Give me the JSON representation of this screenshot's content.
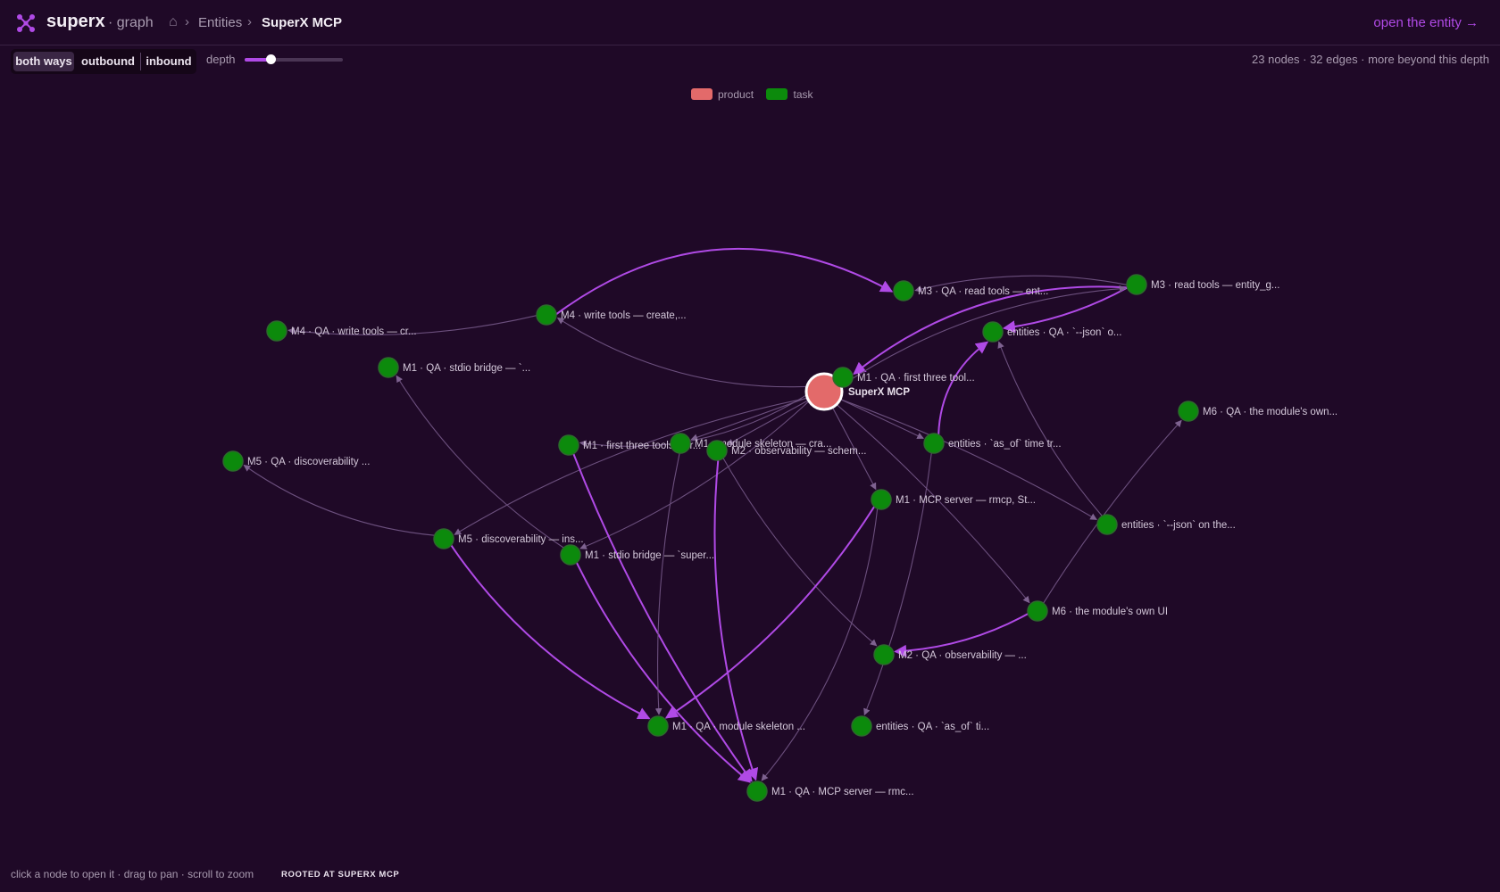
{
  "header": {
    "brand": "superx",
    "brand_suffix": "· graph",
    "home_icon": "⌂",
    "breadcrumb_sep": "›",
    "breadcrumb_parent": "Entities",
    "breadcrumb_current": "SuperX MCP",
    "open_link": "open the entity →"
  },
  "controls": {
    "directions": [
      "both ways",
      "outbound",
      "inbound"
    ],
    "active_direction": "both ways",
    "depth_label": "depth",
    "depth_fraction": 0.26,
    "stats": "23 nodes · 32 edges · more beyond this depth"
  },
  "legend": [
    {
      "label": "product",
      "color": "#e36a6a"
    },
    {
      "label": "task",
      "color": "#0c8a0c"
    }
  ],
  "colors": {
    "background": "#1f0927",
    "accent": "#b04ae6",
    "edge_muted": "#6b4f7d",
    "node_task": "#0c8a0c",
    "node_product": "#e36a6a"
  },
  "graph": {
    "nodes": [
      {
        "id": "root",
        "label": "SuperX MCP",
        "type": "product"
      },
      {
        "id": "m3qa",
        "label": "M3 · QA · read tools — ent...",
        "type": "task"
      },
      {
        "id": "m3",
        "label": "M3 · read tools — entity_g...",
        "type": "task"
      },
      {
        "id": "m4",
        "label": "M4 · write tools — create,...",
        "type": "task"
      },
      {
        "id": "m4qa",
        "label": "M4 · QA · write tools — cr...",
        "type": "task"
      },
      {
        "id": "entqa_json",
        "label": "entities · QA · `--json` o...",
        "type": "task"
      },
      {
        "id": "m1qa_stdio",
        "label": "M1 · QA · stdio bridge — `...",
        "type": "task"
      },
      {
        "id": "m1qa_first",
        "label": "M1 · QA · first three tool...",
        "type": "task"
      },
      {
        "id": "m6qa",
        "label": "M6 · QA · the module's own...",
        "type": "task"
      },
      {
        "id": "m5qa",
        "label": "M5 · QA · discoverability ...",
        "type": "task"
      },
      {
        "id": "m1_first",
        "label": "M1 · first three tools — r...",
        "type": "task"
      },
      {
        "id": "m1_skel",
        "label": "M1 · module skeleton — cra...",
        "type": "task"
      },
      {
        "id": "m2_obs",
        "label": "M2 · observability — schem...",
        "type": "task"
      },
      {
        "id": "ent_asof",
        "label": "entities · `as_of` time tr...",
        "type": "task"
      },
      {
        "id": "m1_mcp",
        "label": "M1 · MCP server — rmcp, St...",
        "type": "task"
      },
      {
        "id": "ent_json",
        "label": "entities · `--json` on the...",
        "type": "task"
      },
      {
        "id": "m5",
        "label": "M5 · discoverability — ins...",
        "type": "task"
      },
      {
        "id": "m1_stdio",
        "label": "M1 · stdio bridge — `super...",
        "type": "task"
      },
      {
        "id": "m6",
        "label": "M6 · the module's own UI",
        "type": "task"
      },
      {
        "id": "m2qa",
        "label": "M2 · QA · observability — ...",
        "type": "task"
      },
      {
        "id": "m1qa_skel",
        "label": "M1 · QA · module skeleton ...",
        "type": "task"
      },
      {
        "id": "entqa_asof",
        "label": "entities · QA · `as_of` ti...",
        "type": "task"
      },
      {
        "id": "m1qa_mcp",
        "label": "M1 · QA · MCP server — rmc...",
        "type": "task"
      }
    ],
    "edges": [
      {
        "from": "m4",
        "to": "m3qa",
        "strong": true
      },
      {
        "from": "m3",
        "to": "m3qa",
        "strong": false
      },
      {
        "from": "m3",
        "to": "m1qa_first",
        "strong": true
      },
      {
        "from": "m3",
        "to": "entqa_json",
        "strong": true
      },
      {
        "from": "root",
        "to": "m3",
        "strong": false
      },
      {
        "from": "root",
        "to": "m4",
        "strong": false
      },
      {
        "from": "m4",
        "to": "m4qa",
        "strong": false
      },
      {
        "from": "root",
        "to": "m1_first",
        "strong": false
      },
      {
        "from": "root",
        "to": "m1_skel",
        "strong": false
      },
      {
        "from": "root",
        "to": "m2_obs",
        "strong": false
      },
      {
        "from": "root",
        "to": "ent_asof",
        "strong": false
      },
      {
        "from": "root",
        "to": "m1_mcp",
        "strong": false
      },
      {
        "from": "root",
        "to": "ent_json",
        "strong": false
      },
      {
        "from": "root",
        "to": "m6",
        "strong": false
      },
      {
        "from": "root",
        "to": "m5",
        "strong": false
      },
      {
        "from": "root",
        "to": "m1_stdio",
        "strong": false
      },
      {
        "from": "ent_asof",
        "to": "entqa_json",
        "strong": true
      },
      {
        "from": "ent_json",
        "to": "entqa_json",
        "strong": false
      },
      {
        "from": "m6",
        "to": "m6qa",
        "strong": false
      },
      {
        "from": "m6",
        "to": "m2qa",
        "strong": true
      },
      {
        "from": "m2_obs",
        "to": "m2qa",
        "strong": false
      },
      {
        "from": "m5",
        "to": "m5qa",
        "strong": false
      },
      {
        "from": "m1_stdio",
        "to": "m1qa_stdio",
        "strong": false
      },
      {
        "from": "m1_first",
        "to": "m1qa_mcp",
        "strong": true
      },
      {
        "from": "m2_obs",
        "to": "m1qa_mcp",
        "strong": true
      },
      {
        "from": "m5",
        "to": "m1qa_skel",
        "strong": true
      },
      {
        "from": "m1_stdio",
        "to": "m1qa_mcp",
        "strong": true
      },
      {
        "from": "m1_mcp",
        "to": "m1qa_skel",
        "strong": true
      },
      {
        "from": "m1_mcp",
        "to": "m1qa_mcp",
        "strong": false
      },
      {
        "from": "m1_skel",
        "to": "m1qa_skel",
        "strong": false
      },
      {
        "from": "ent_asof",
        "to": "entqa_asof",
        "strong": false
      },
      {
        "from": "root",
        "to": "m1qa_first",
        "strong": false
      }
    ]
  },
  "footer": {
    "hint": "click a node to open it · drag to pan · scroll to zoom",
    "badge": "ROOTED AT SUPERX MCP"
  }
}
